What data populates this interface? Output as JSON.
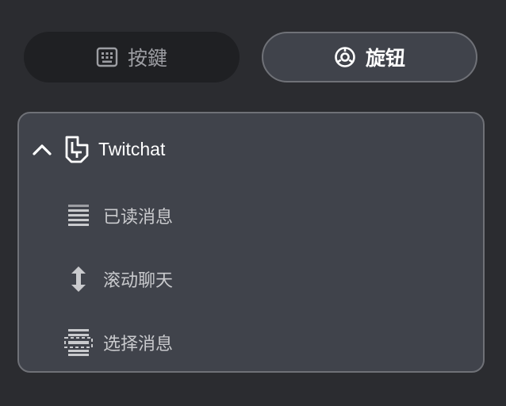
{
  "mode_tabs": {
    "keys": {
      "label": "按鍵",
      "icon": "keyboard-icon",
      "selected": false
    },
    "knob": {
      "label": "旋钮",
      "icon": "knob-icon",
      "selected": true
    }
  },
  "tree": {
    "expanded": true,
    "toggle_icon": "chevron-up-icon",
    "icon": "twitchat-logo-icon",
    "title": "Twitchat",
    "items": [
      {
        "label": "已读消息",
        "icon": "read-messages-icon"
      },
      {
        "label": "滚动聊天",
        "icon": "scroll-vertical-icon"
      },
      {
        "label": "选择消息",
        "icon": "select-message-icon"
      }
    ]
  },
  "colors": {
    "background": "#2b2c30",
    "panel": "#40434b",
    "border": "#6f7177",
    "inactive_tab": "#1f2023"
  }
}
